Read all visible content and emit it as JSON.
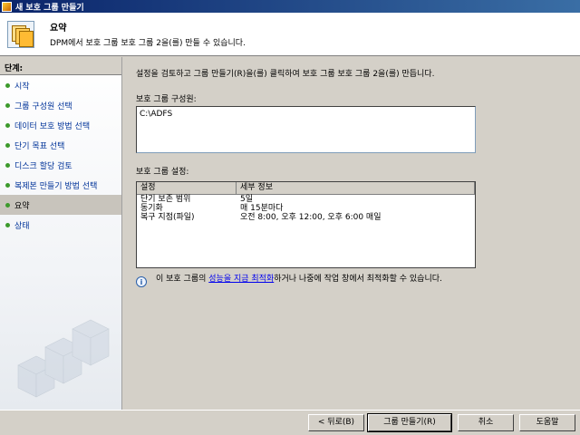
{
  "window": {
    "title": "새 보호 그룹 만들기"
  },
  "header": {
    "title": "요약",
    "subtitle": "DPM에서 보호 그룹 보호 그룹 2을(를) 만들 수 있습니다."
  },
  "sidebar": {
    "header": "단계:",
    "steps": [
      {
        "label": "시작"
      },
      {
        "label": "그룹 구성원 선택"
      },
      {
        "label": "데이터 보호 방법 선택"
      },
      {
        "label": "단기 목표 선택"
      },
      {
        "label": "디스크 할당 검토"
      },
      {
        "label": "복제본 만들기 방법 선택"
      },
      {
        "label": "요약"
      },
      {
        "label": "상태"
      }
    ]
  },
  "main": {
    "instruction": "설정을 검토하고 그룹 만들기(R)을(를) 클릭하여 보호 그룹 보호 그룹 2을(를) 만듭니다.",
    "members_label": "보호 그룹 구성원:",
    "members": [
      "C:\\ADFS"
    ],
    "settings_label": "보호 그룹 설정:",
    "settings_headers": [
      "설정",
      "세부 정보"
    ],
    "settings_rows": [
      [
        "단기 보존 범위",
        "5일"
      ],
      [
        "동기화",
        "매 15분마다"
      ],
      [
        "복구 지점(파일)",
        "오전 8:00, 오후 12:00, 오후 6:00 매일"
      ]
    ],
    "info_prefix": "이 보호 그룹의 ",
    "info_link": "성능을 지금 최적화",
    "info_suffix": "하거나 나중에 작업 창에서 최적화할 수 있습니다."
  },
  "buttons": {
    "back": "< 뒤로(B)",
    "create": "그룹 만들기(R)",
    "cancel": "취소",
    "help": "도움말"
  }
}
